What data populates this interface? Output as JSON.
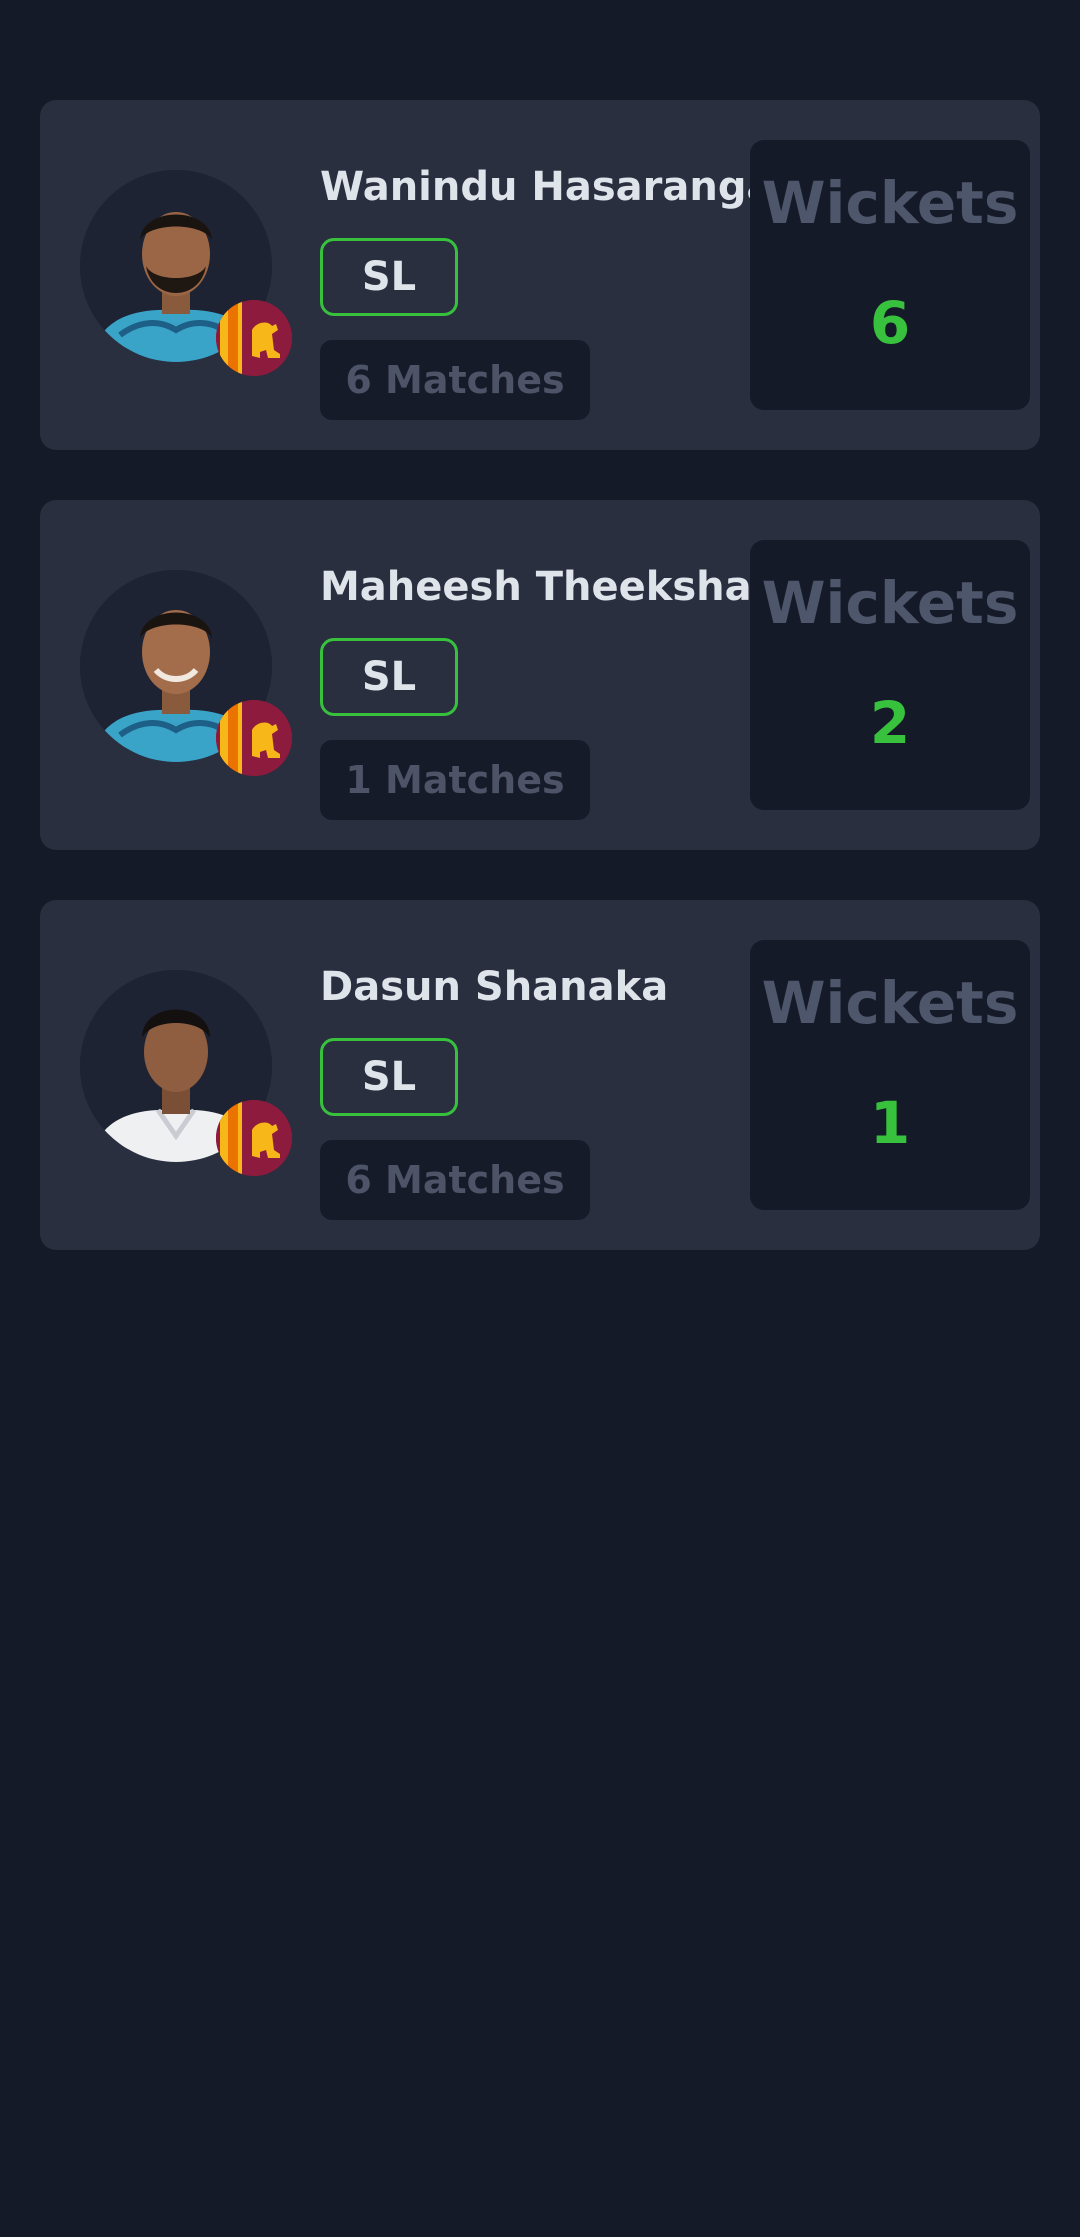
{
  "colors": {
    "background": "#151a28",
    "card": "#2a2f40",
    "accent": "#38c13d",
    "muted": "#4e566b"
  },
  "players": [
    {
      "name": "Wanindu Hasaranga",
      "team": "SL",
      "matches": "6 Matches",
      "stat_label": "Wickets",
      "stat_value": "6",
      "avatar_icon": "player-photo",
      "flag_icon": "sri-lanka-flag-icon",
      "jersey": "blue"
    },
    {
      "name": "Maheesh Theeksha",
      "team": "SL",
      "matches": "1 Matches",
      "stat_label": "Wickets",
      "stat_value": "2",
      "avatar_icon": "player-photo",
      "flag_icon": "sri-lanka-flag-icon",
      "jersey": "blue"
    },
    {
      "name": "Dasun Shanaka",
      "team": "SL",
      "matches": "6 Matches",
      "stat_label": "Wickets",
      "stat_value": "1",
      "avatar_icon": "player-photo",
      "flag_icon": "sri-lanka-flag-icon",
      "jersey": "white"
    }
  ]
}
